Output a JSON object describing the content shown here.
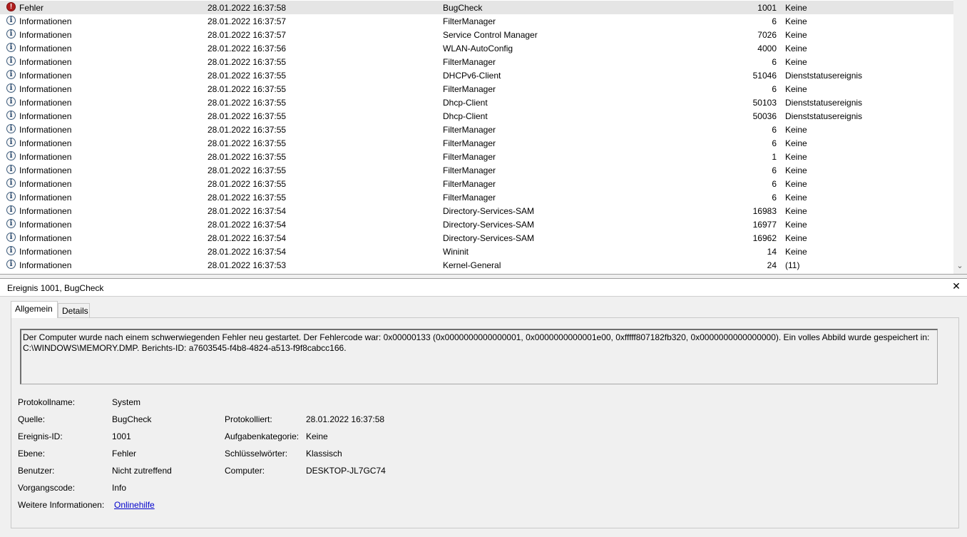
{
  "event_list": {
    "rows": [
      {
        "level": "Fehler",
        "date": "28.01.2022 16:37:58",
        "source": "BugCheck",
        "id": "1001",
        "task": "Keine",
        "icon": "error-icon",
        "selected": true
      },
      {
        "level": "Informationen",
        "date": "28.01.2022 16:37:57",
        "source": "FilterManager",
        "id": "6",
        "task": "Keine",
        "icon": "info-icon"
      },
      {
        "level": "Informationen",
        "date": "28.01.2022 16:37:57",
        "source": "Service Control Manager",
        "id": "7026",
        "task": "Keine",
        "icon": "info-icon"
      },
      {
        "level": "Informationen",
        "date": "28.01.2022 16:37:56",
        "source": "WLAN-AutoConfig",
        "id": "4000",
        "task": "Keine",
        "icon": "info-icon"
      },
      {
        "level": "Informationen",
        "date": "28.01.2022 16:37:55",
        "source": "FilterManager",
        "id": "6",
        "task": "Keine",
        "icon": "info-icon"
      },
      {
        "level": "Informationen",
        "date": "28.01.2022 16:37:55",
        "source": "DHCPv6-Client",
        "id": "51046",
        "task": "Dienststatusereignis",
        "icon": "info-icon"
      },
      {
        "level": "Informationen",
        "date": "28.01.2022 16:37:55",
        "source": "FilterManager",
        "id": "6",
        "task": "Keine",
        "icon": "info-icon"
      },
      {
        "level": "Informationen",
        "date": "28.01.2022 16:37:55",
        "source": "Dhcp-Client",
        "id": "50103",
        "task": "Dienststatusereignis",
        "icon": "info-icon"
      },
      {
        "level": "Informationen",
        "date": "28.01.2022 16:37:55",
        "source": "Dhcp-Client",
        "id": "50036",
        "task": "Dienststatusereignis",
        "icon": "info-icon"
      },
      {
        "level": "Informationen",
        "date": "28.01.2022 16:37:55",
        "source": "FilterManager",
        "id": "6",
        "task": "Keine",
        "icon": "info-icon"
      },
      {
        "level": "Informationen",
        "date": "28.01.2022 16:37:55",
        "source": "FilterManager",
        "id": "6",
        "task": "Keine",
        "icon": "info-icon"
      },
      {
        "level": "Informationen",
        "date": "28.01.2022 16:37:55",
        "source": "FilterManager",
        "id": "1",
        "task": "Keine",
        "icon": "info-icon"
      },
      {
        "level": "Informationen",
        "date": "28.01.2022 16:37:55",
        "source": "FilterManager",
        "id": "6",
        "task": "Keine",
        "icon": "info-icon"
      },
      {
        "level": "Informationen",
        "date": "28.01.2022 16:37:55",
        "source": "FilterManager",
        "id": "6",
        "task": "Keine",
        "icon": "info-icon"
      },
      {
        "level": "Informationen",
        "date": "28.01.2022 16:37:55",
        "source": "FilterManager",
        "id": "6",
        "task": "Keine",
        "icon": "info-icon"
      },
      {
        "level": "Informationen",
        "date": "28.01.2022 16:37:54",
        "source": "Directory-Services-SAM",
        "id": "16983",
        "task": "Keine",
        "icon": "info-icon"
      },
      {
        "level": "Informationen",
        "date": "28.01.2022 16:37:54",
        "source": "Directory-Services-SAM",
        "id": "16977",
        "task": "Keine",
        "icon": "info-icon"
      },
      {
        "level": "Informationen",
        "date": "28.01.2022 16:37:54",
        "source": "Directory-Services-SAM",
        "id": "16962",
        "task": "Keine",
        "icon": "info-icon"
      },
      {
        "level": "Informationen",
        "date": "28.01.2022 16:37:54",
        "source": "Wininit",
        "id": "14",
        "task": "Keine",
        "icon": "info-icon"
      },
      {
        "level": "Informationen",
        "date": "28.01.2022 16:37:53",
        "source": "Kernel-General",
        "id": "24",
        "task": "(11)",
        "icon": "info-icon"
      }
    ]
  },
  "detail": {
    "title": "Ereignis 1001, BugCheck",
    "close_glyph": "✕",
    "tabs": {
      "general": "Allgemein",
      "details": "Details"
    },
    "message": "Der Computer wurde nach einem schwerwiegenden Fehler neu gestartet. Der Fehlercode war: 0x00000133 (0x0000000000000001, 0x0000000000001e00, 0xfffff807182fb320, 0x0000000000000000). Ein volles Abbild wurde gespeichert in: C:\\WINDOWS\\MEMORY.DMP. Berichts-ID: a7603545-f4b8-4824-a513-f9f8cabcc166.",
    "fields": {
      "log_name": {
        "label": "Protokollname:",
        "value": "System"
      },
      "source": {
        "label": "Quelle:",
        "value": "BugCheck"
      },
      "logged": {
        "label": "Protokolliert:",
        "value": "28.01.2022 16:37:58"
      },
      "event_id": {
        "label": "Ereignis-ID:",
        "value": "1001"
      },
      "task_category": {
        "label": "Aufgabenkategorie:",
        "value": "Keine"
      },
      "level": {
        "label": "Ebene:",
        "value": "Fehler"
      },
      "keywords": {
        "label": "Schlüsselwörter:",
        "value": "Klassisch"
      },
      "user": {
        "label": "Benutzer:",
        "value": "Nicht zutreffend"
      },
      "computer": {
        "label": "Computer:",
        "value": "DESKTOP-JL7GC74"
      },
      "opcode": {
        "label": "Vorgangscode:",
        "value": "Info"
      },
      "more_info": {
        "label": "Weitere Informationen:",
        "value": "Onlinehilfe"
      }
    }
  }
}
